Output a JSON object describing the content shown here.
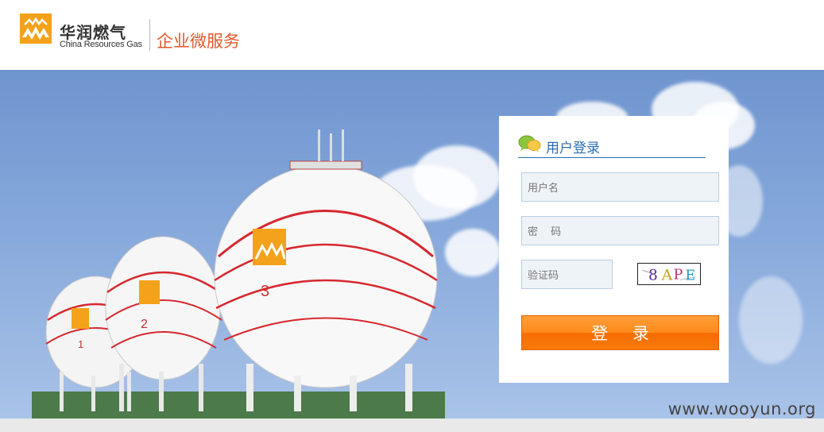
{
  "header": {
    "brand_cn": "华润燃气",
    "brand_en": "China Resources Gas",
    "service_title": "企业微服务"
  },
  "login": {
    "title": "用户登录",
    "username_placeholder": "用户名",
    "password_placeholder": "密 码",
    "captcha_placeholder": "验证码",
    "captcha_text": "8APE",
    "submit_label": "登 录"
  },
  "watermark": "www.wooyun.org",
  "colors": {
    "accent_blue": "#2a6db5",
    "brand_orange": "#e05a2b",
    "button_orange": "#ff8a1a"
  },
  "banner": {
    "tank_numbers": [
      "1",
      "2",
      "3"
    ]
  }
}
